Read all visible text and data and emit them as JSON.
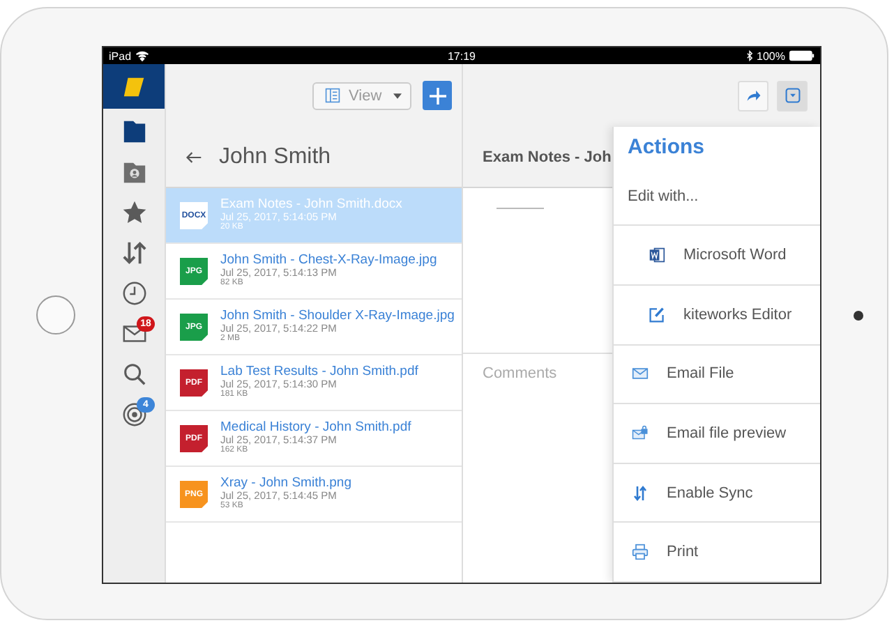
{
  "status_bar": {
    "device": "iPad",
    "time": "17:19",
    "battery": "100%"
  },
  "sidebar": {
    "items": [
      {
        "kind": "logo",
        "selected": true
      },
      {
        "kind": "folder",
        "selected": false
      },
      {
        "kind": "shared",
        "selected": false
      },
      {
        "kind": "star",
        "selected": false
      },
      {
        "kind": "sort",
        "selected": false
      },
      {
        "kind": "clock",
        "selected": false
      },
      {
        "kind": "mail",
        "selected": false,
        "badge": "18",
        "color": "#d0161b"
      },
      {
        "kind": "search",
        "selected": false
      },
      {
        "kind": "target",
        "selected": false,
        "badge": "4",
        "color": "#3d85d8"
      }
    ]
  },
  "toolbar": {
    "view_button": "View"
  },
  "file_list": {
    "title": "John Smith",
    "files": [
      {
        "name": "Exam Notes - John Smith.docx",
        "date": "Jul 25, 2017, 5:14:05 PM",
        "size": "20 KB",
        "type": "DOCX",
        "color": "#ffffff",
        "selected": true
      },
      {
        "name": "John Smith - Chest-X-Ray-Image.jpg",
        "date": "Jul 25, 2017, 5:14:13 PM",
        "size": "82 KB",
        "type": "JPG",
        "color": "#1a9e4a",
        "selected": false
      },
      {
        "name": "John Smith - Shoulder X-Ray-Image.jpg",
        "date": "Jul 25, 2017, 5:14:22 PM",
        "size": "2 MB",
        "type": "JPG",
        "color": "#1a9e4a",
        "selected": false
      },
      {
        "name": "Lab Test Results - John Smith.pdf",
        "date": "Jul 25, 2017, 5:14:30 PM",
        "size": "181 KB",
        "type": "PDF",
        "color": "#c4202e",
        "selected": false
      },
      {
        "name": "Medical History - John Smith.pdf",
        "date": "Jul 25, 2017, 5:14:37 PM",
        "size": "162 KB",
        "type": "PDF",
        "color": "#c4202e",
        "selected": false
      },
      {
        "name": "Xray - John Smith.png",
        "date": "Jul 25, 2017, 5:14:45 PM",
        "size": "53 KB",
        "type": "PNG",
        "color": "#f7931e",
        "selected": false
      }
    ]
  },
  "preview": {
    "title": "Exam Notes - Joh",
    "comments_label": "Comments"
  },
  "actions": {
    "title": "Actions",
    "items": [
      {
        "label": "Edit with...",
        "kind": "heading",
        "children": [
          {
            "label": "Microsoft Word",
            "kind": "word"
          },
          {
            "label": "kiteworks Editor",
            "kind": "edit"
          }
        ]
      },
      {
        "label": "Email File",
        "kind": "mail"
      },
      {
        "label": "Email file preview",
        "kind": "secure"
      },
      {
        "label": "Enable Sync",
        "kind": "sync"
      },
      {
        "label": "Print",
        "kind": "print"
      }
    ]
  }
}
